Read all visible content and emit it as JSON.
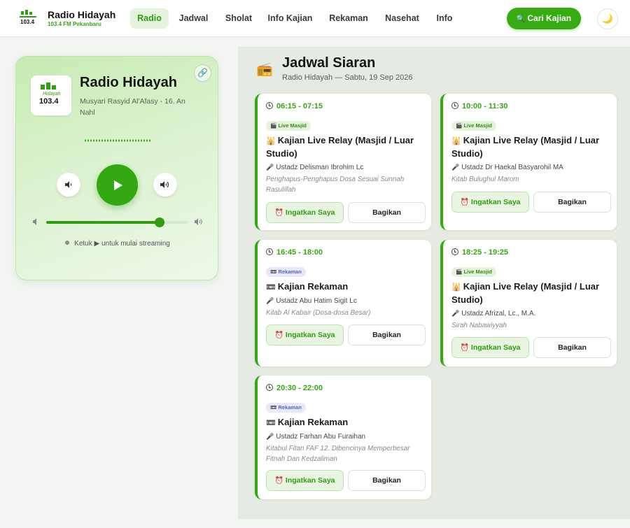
{
  "nav": {
    "brand_title": "Radio Hidayah",
    "brand_sub": "103.4 FM Pekanbaru",
    "items": [
      "Radio",
      "Jadwal",
      "Sholat",
      "Info Kajian",
      "Rekaman",
      "Nasehat",
      "Info"
    ],
    "active_item": "Radio",
    "cta_label": "Cari Kajian",
    "cta_icon": "search-icon",
    "theme_icon": "moon-icon"
  },
  "player": {
    "title": "Radio Hidayah",
    "track": "Musyari Rasyid Al'Afasy - 16. An Nahl",
    "status": "Ketuk ▶ untuk mulai streaming",
    "volume_percent": 80,
    "logo_text": "103.4"
  },
  "schedule": {
    "title": "Jadwal Siaran",
    "subtitle": "Radio Hidayah — Sabtu, 19 Sep 2026",
    "reminder_label": "Ingatkan Saya",
    "share_label": "Bagikan",
    "items": [
      {
        "time": "06:15 - 07:15",
        "badge": "Live Masjid",
        "type": "live",
        "title": "Kajian Live Relay (Masjid / Luar Studio)",
        "speaker": "Ustadz Delisman Ibrohim Lc",
        "desc": "Penghapus-Penghapus Dosa Sesuai Sunnah Rasulillah"
      },
      {
        "time": "10:00 - 11:30",
        "badge": "Live Masjid",
        "type": "live",
        "title": "Kajian Live Relay (Masjid / Luar Studio)",
        "speaker": "Ustadz Dr Haekal Basyarohil MA",
        "desc": "Kitab Bulughul Marom"
      },
      {
        "time": "16:45 - 18:00",
        "badge": "Rekaman",
        "type": "rec",
        "title": "Kajian Rekaman",
        "speaker": "Ustadz Abu Hatim Sigit Lc",
        "desc": "Kitab Al Kabair (Dosa-dosa Besar)"
      },
      {
        "time": "18:25 - 19:25",
        "badge": "Live Masjid",
        "type": "live",
        "title": "Kajian Live Relay (Masjid / Luar Studio)",
        "speaker": "Ustadz Afrizal, Lc., M.A.",
        "desc": "Sirah Nabawiyyah"
      },
      {
        "time": "20:30 - 22:00",
        "badge": "Rekaman",
        "type": "rec",
        "title": "Kajian Rekaman",
        "speaker": "Ustadz Farhan Abu Furaihan",
        "desc": "Kitabul Fitan FAF 12. Dibencinya Memperbesar Fitnah Dan Kedzaliman"
      }
    ]
  },
  "colors": {
    "accent": "#35a912",
    "live_badge": "#e4f4dc",
    "rec_badge": "#e6e8fb"
  }
}
